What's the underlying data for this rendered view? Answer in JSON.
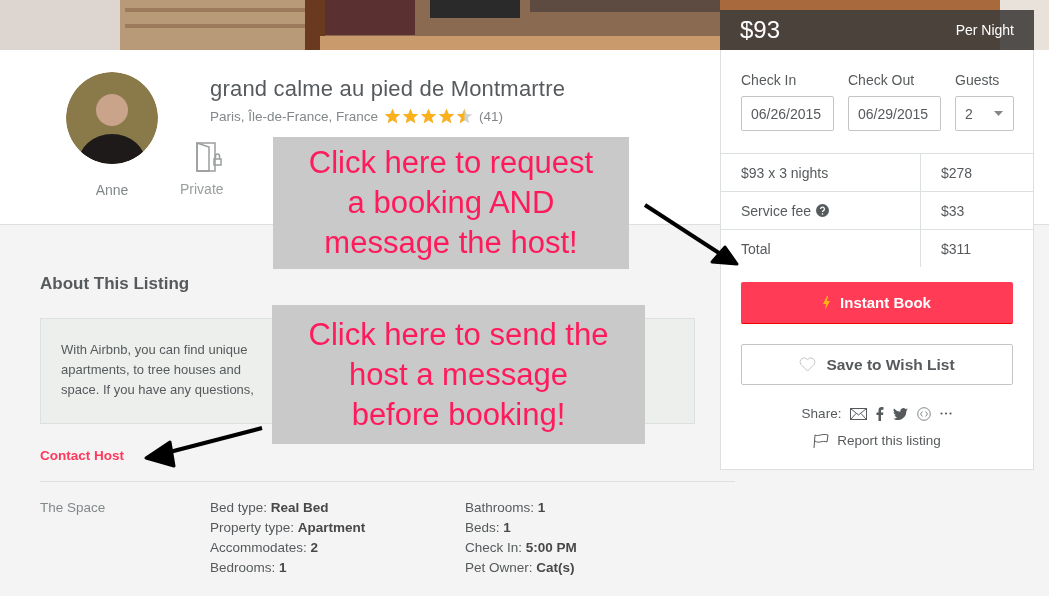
{
  "listing": {
    "host_name": "Anne",
    "title": "grand calme au pied de Montmartre",
    "location": "Paris, Île-de-France, France",
    "stars": 4.5,
    "review_count": "(41)",
    "amenities": [
      {
        "kind": "room",
        "label": "Private"
      }
    ]
  },
  "booking": {
    "price": "$93",
    "price_unit": "Per Night",
    "fields": [
      {
        "kind": "date",
        "label": "Check In",
        "value": "06/26/2015"
      },
      {
        "kind": "date",
        "label": "Check Out",
        "value": "06/29/2015"
      },
      {
        "kind": "select",
        "label": "Guests",
        "value": "2"
      }
    ],
    "price_rows": [
      {
        "label": "$93 x 3 nights",
        "amount": "$278",
        "help": false
      },
      {
        "label": "Service fee",
        "amount": "$33",
        "help": true
      },
      {
        "label": "Total",
        "amount": "$311",
        "help": false
      }
    ],
    "instant_book": "Instant Book",
    "wish_list": "Save to Wish List",
    "share_label": "Share:",
    "report": "Report this listing"
  },
  "about": {
    "heading": "About This Listing",
    "description_lines": [
      "With Airbnb, you can find unique",
      "apartments, to tree houses and",
      "space. If you have any questions,"
    ],
    "contact_link": "Contact Host"
  },
  "space": {
    "label": "The Space",
    "columns": [
      [
        "Bed type: **Real Bed**",
        "Property type: **Apartment**",
        "Accommodates: **2**",
        "Bedrooms: **1**"
      ],
      [
        "Bathrooms: **1**",
        "Beds: **1**",
        "Check In: **5:00 PM**",
        "Pet Owner: **Cat(s)**"
      ]
    ]
  },
  "annotations": [
    {
      "lines": [
        "Click here to request",
        "a booking AND",
        "message the host!"
      ]
    },
    {
      "lines": [
        "Click here to send the",
        "host a message",
        "before booking!"
      ]
    }
  ]
}
